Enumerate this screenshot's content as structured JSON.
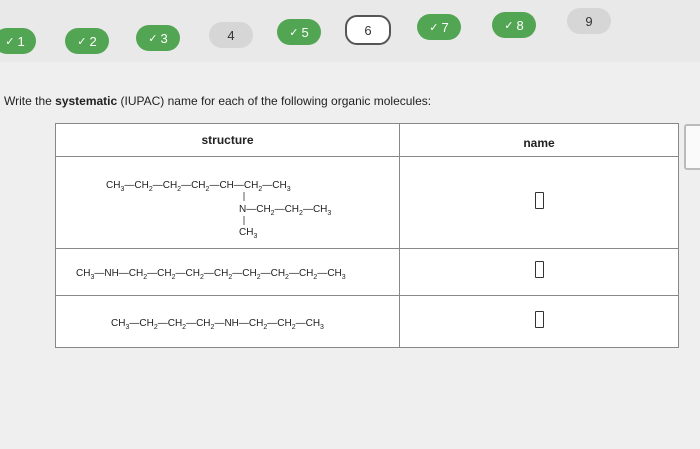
{
  "progress": {
    "items": [
      {
        "label": "1",
        "state": "done"
      },
      {
        "label": "2",
        "state": "done"
      },
      {
        "label": "3",
        "state": "done"
      },
      {
        "label": "4",
        "state": "todo"
      },
      {
        "label": "5",
        "state": "done"
      },
      {
        "label": "6",
        "state": "current"
      },
      {
        "label": "7",
        "state": "done"
      },
      {
        "label": "8",
        "state": "done"
      },
      {
        "label": "9",
        "state": "todo"
      }
    ]
  },
  "question": {
    "prefix": "Write the ",
    "bold": "systematic",
    "suffix": " (IUPAC) name for each of the following organic molecules:"
  },
  "table": {
    "col_structure": "structure",
    "col_name": "name"
  },
  "colors": {
    "done": "#52a552",
    "todo": "#d6d6d6"
  }
}
